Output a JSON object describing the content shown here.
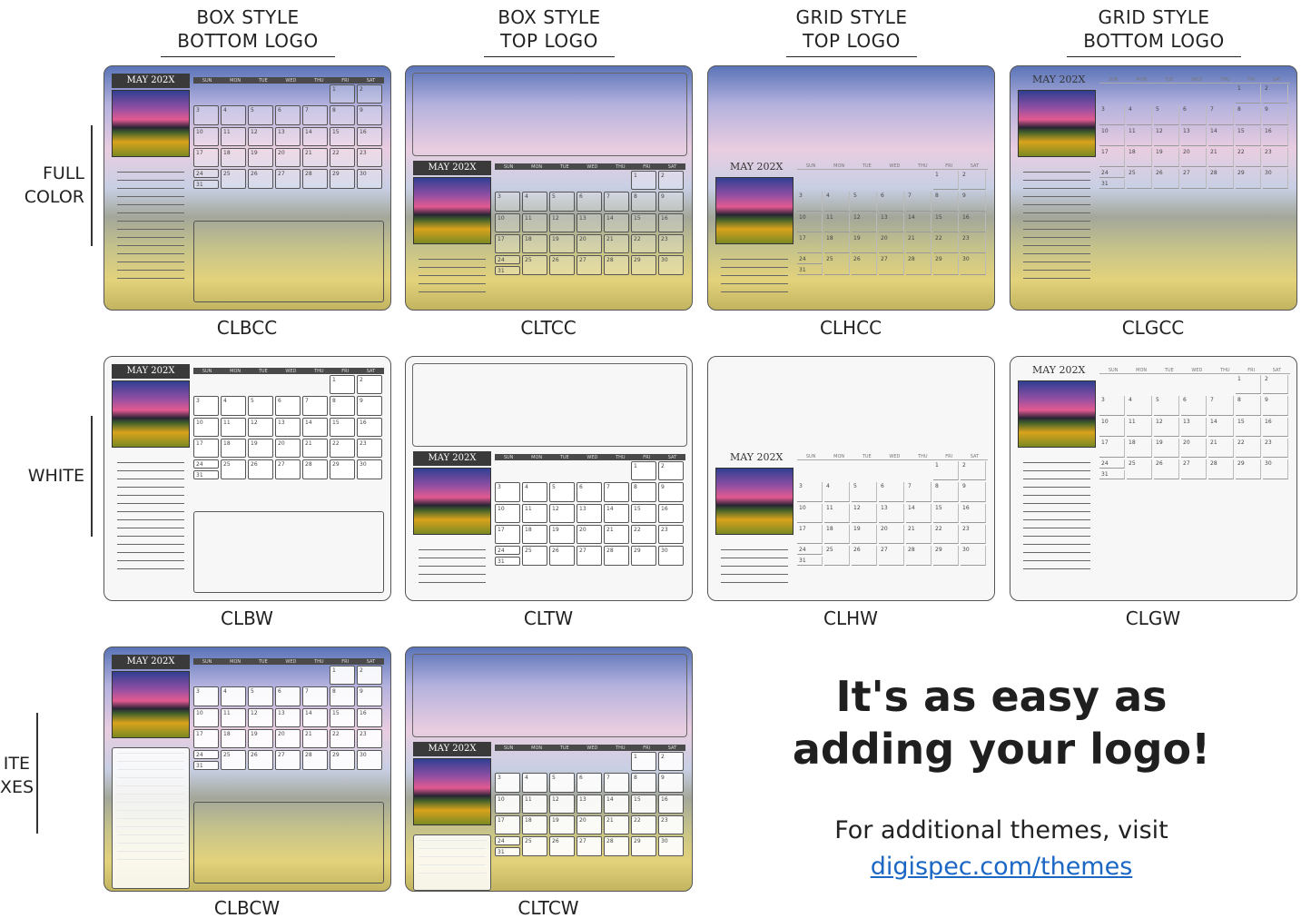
{
  "columns": [
    {
      "line1": "BOX STYLE",
      "line2": "BOTTOM LOGO"
    },
    {
      "line1": "BOX STYLE",
      "line2": "TOP LOGO"
    },
    {
      "line1": "GRID STYLE",
      "line2": "TOP LOGO"
    },
    {
      "line1": "GRID STYLE",
      "line2": "BOTTOM LOGO"
    }
  ],
  "rows": [
    {
      "line1": "FULL",
      "line2": "COLOR"
    },
    {
      "line1": "WHITE",
      "line2": ""
    },
    {
      "line1": "ITE",
      "line2": "XES"
    }
  ],
  "calendar": {
    "month": "MAY 202X",
    "days": [
      "SUN",
      "MON",
      "TUE",
      "WED",
      "THU",
      "FRI",
      "SAT"
    ],
    "dates": [
      "1",
      "2",
      "3",
      "4",
      "5",
      "6",
      "7",
      "8",
      "9",
      "10",
      "11",
      "12",
      "13",
      "14",
      "15",
      "16",
      "17",
      "18",
      "19",
      "20",
      "21",
      "22",
      "23",
      "24",
      "25",
      "26",
      "27",
      "28",
      "29",
      "30",
      "31"
    ]
  },
  "codes": [
    "CLBCC",
    "CLTCC",
    "CLHCC",
    "CLGCC",
    "CLBW",
    "CLTW",
    "CLHW",
    "CLGW",
    "CLBCW",
    "CLTCW"
  ],
  "promo": {
    "headline1": "It's as easy as",
    "headline2": "adding your logo!",
    "visit_text": "For additional themes, visit",
    "link_text": "digispec.com/themes"
  }
}
